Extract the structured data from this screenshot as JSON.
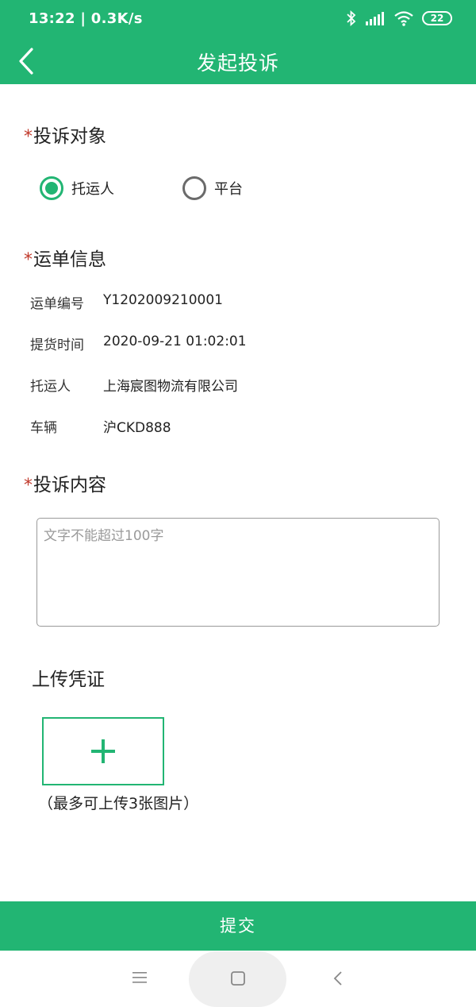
{
  "status_bar": {
    "time": "13:22 | 0.3K/s",
    "battery": "22",
    "icons": [
      "bluetooth-icon",
      "signal-icon",
      "wifi-icon",
      "battery-icon"
    ]
  },
  "header": {
    "title": "发起投诉",
    "back_icon": "chevron-left-icon"
  },
  "complaint_target": {
    "required_mark": "*",
    "title": "投诉对象",
    "options": [
      {
        "label": "托运人",
        "selected": true
      },
      {
        "label": "平台",
        "selected": false
      }
    ]
  },
  "waybill": {
    "required_mark": "*",
    "title": "运单信息",
    "rows": [
      {
        "label": "运单编号",
        "value": "Y1202009210001"
      },
      {
        "label": "提货时间",
        "value": "2020-09-21 01:02:01"
      },
      {
        "label": "托运人",
        "value": "上海宸图物流有限公司"
      },
      {
        "label": "车辆",
        "value": "沪CKD888"
      }
    ]
  },
  "content": {
    "required_mark": "*",
    "title": "投诉内容",
    "placeholder": "文字不能超过100字",
    "value": ""
  },
  "upload": {
    "title": "上传凭证",
    "hint": "（最多可上传3张图片）",
    "icon": "plus-icon"
  },
  "submit_label": "提交",
  "colors": {
    "primary": "#22b573",
    "required": "#c0392b",
    "placeholder": "#9a9a9a"
  }
}
